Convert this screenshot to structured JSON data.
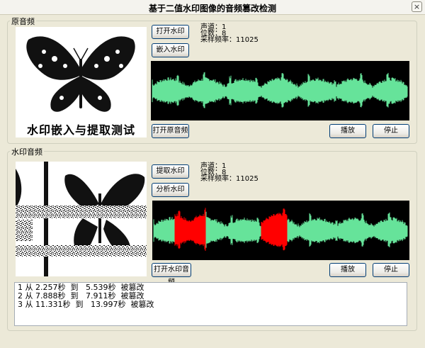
{
  "window": {
    "title": "基于二值水印图像的音频篡改检测",
    "close_label": "×"
  },
  "original_group": {
    "label": "原音频",
    "buttons": {
      "open_watermark": "打开水印",
      "embed_watermark": "嵌入水印",
      "open_original": "打开原音频",
      "play": "播放",
      "stop": "停止"
    },
    "info": {
      "channels": "声道：1",
      "bits": "位数：8",
      "sample_rate": "采样频率：11025"
    },
    "watermark_image_text": "水印嵌入与提取测试"
  },
  "watermarked_group": {
    "label": "水印音频",
    "buttons": {
      "extract_watermark": "提取水印",
      "analyze_watermark": "分析水印",
      "open_watermarked": "打开水印音频",
      "play": "播放",
      "stop": "停止"
    },
    "info": {
      "channels": "声道：1",
      "bits": "位数：8",
      "sample_rate": "采样频率：11025"
    }
  },
  "log_lines": [
    "1 从 2.257秒  到   5.539秒  被篡改",
    "2 从 7.888秒  到   7.911秒  被篡改",
    "3 从 11.331秒  到   13.997秒  被篡改"
  ],
  "colors": {
    "wave": "#66e39a",
    "tamper": "#ff0000",
    "wave_bg": "#000000"
  },
  "tamper_segments_seconds": [
    [
      2.257,
      5.539
    ],
    [
      7.888,
      7.911
    ],
    [
      11.331,
      13.997
    ]
  ]
}
